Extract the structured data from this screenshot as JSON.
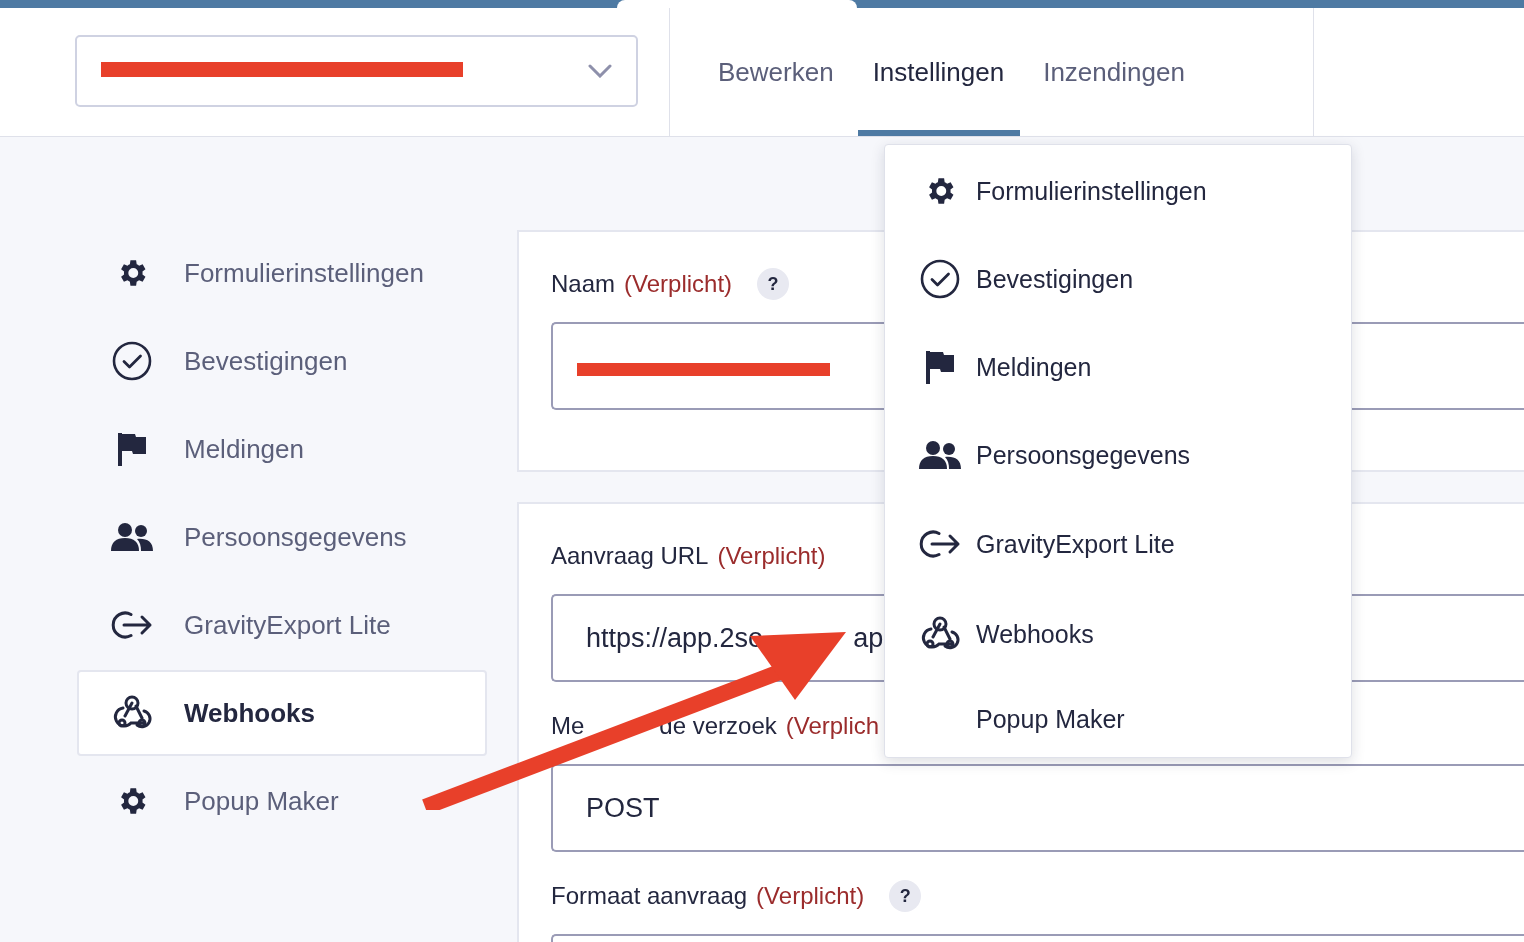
{
  "form_selector": {
    "value_redacted": true
  },
  "tabs": [
    {
      "label": "Bewerken",
      "selected": false
    },
    {
      "label": "Instellingen",
      "selected": true
    },
    {
      "label": "Inzendingen",
      "selected": false
    }
  ],
  "sidebar": {
    "items": [
      {
        "label": "Formulierinstellingen",
        "selected": false
      },
      {
        "label": "Bevestigingen",
        "selected": false
      },
      {
        "label": "Meldingen",
        "selected": false
      },
      {
        "label": "Persoonsgegevens",
        "selected": false
      },
      {
        "label": "GravityExport Lite",
        "selected": false
      },
      {
        "label": "Webhooks",
        "selected": true
      },
      {
        "label": "Popup Maker",
        "selected": false
      }
    ]
  },
  "cards": [
    {
      "fields": [
        {
          "label": "Naam",
          "required": "(Verplicht)",
          "help": "?",
          "value_redacted": true
        }
      ]
    },
    {
      "fields": [
        {
          "label": "Aanvraag URL",
          "required": "(Verplicht)",
          "value_parts": [
            "https://app.2so",
            "ap"
          ]
        },
        {
          "label_parts": [
            "Me",
            "de verzoek"
          ],
          "required": "(Verplich",
          "value_parts": [
            "POST"
          ]
        },
        {
          "label": "Formaat aanvraag",
          "required": "(Verplicht)",
          "help": "?"
        }
      ]
    }
  ],
  "dropdown_menu": {
    "items": [
      {
        "label": "Formulierinstellingen"
      },
      {
        "label": "Bevestigingen"
      },
      {
        "label": "Meldingen"
      },
      {
        "label": "Persoonsgegevens"
      },
      {
        "label": "GravityExport Lite"
      },
      {
        "label": "Webhooks"
      },
      {
        "label": "Popup Maker"
      }
    ]
  },
  "annotation_arrow": {
    "color": "#e8402a"
  }
}
